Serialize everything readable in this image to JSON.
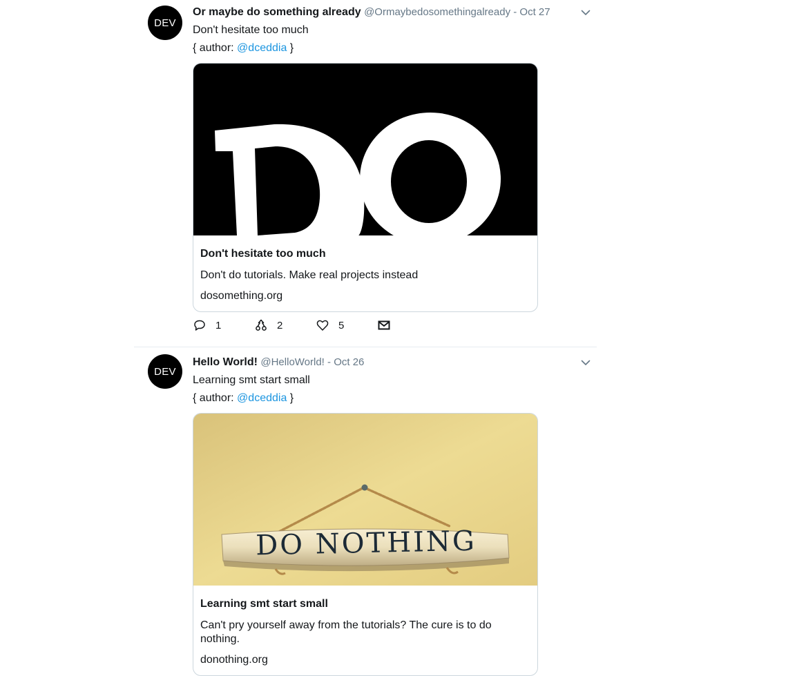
{
  "tweets": [
    {
      "avatar_text": "DEV",
      "name": "Or maybe do something already",
      "handle": "@Ormaybedosomethingalready",
      "sep": " - ",
      "date": "Oct 27",
      "text": "Don't hesitate too much",
      "author_prefix": "{ author: ",
      "author_mention": "@dceddia",
      "author_suffix": " }",
      "card": {
        "image": "do-image",
        "title": "Don't hesitate too much",
        "description": "Don't do tutorials. Make real projects instead",
        "domain": "dosomething.org"
      },
      "counts": {
        "replies": "1",
        "retweets": "2",
        "likes": "5"
      }
    },
    {
      "avatar_text": "DEV",
      "name": "Hello World!",
      "handle": "@HelloWorld!",
      "sep": " - ",
      "date": "Oct 26",
      "text": "Learning smt start small",
      "author_prefix": "{ author: ",
      "author_mention": "@dceddia",
      "author_suffix": " }",
      "card": {
        "image": "do-nothing-sign-image",
        "title": "Learning smt start small",
        "description": "Can't pry yourself away from the tutorials? The cure is to do nothing.",
        "domain": "donothing.org",
        "sign_text": "DO NOTHING"
      }
    }
  ],
  "icons": {
    "caret": "chevron-down-icon",
    "reply": "reply-icon",
    "retweet": "retweet-icon",
    "like": "heart-icon",
    "message": "envelope-icon"
  },
  "colors": {
    "link": "#1b95e0",
    "muted": "#657786",
    "text": "#14171a",
    "border": "#ccd6dd",
    "sign_wall": "#e8d587"
  }
}
